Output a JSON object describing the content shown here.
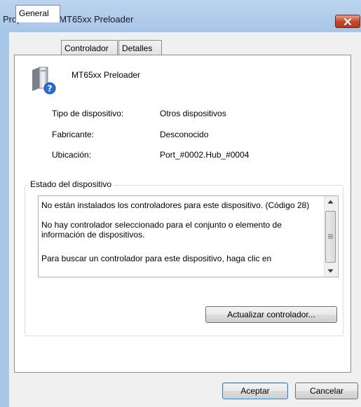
{
  "window": {
    "title": "Propiedades: MT65xx Preloader"
  },
  "tabs": [
    {
      "label": "General"
    },
    {
      "label": "Controlador"
    },
    {
      "label": "Detalles"
    }
  ],
  "device": {
    "name": "MT65xx Preloader",
    "icon": "device-unknown-icon"
  },
  "properties": [
    {
      "label": "Tipo de dispositivo:",
      "value": "Otros dispositivos"
    },
    {
      "label": "Fabricante:",
      "value": "Desconocido"
    },
    {
      "label": "Ubicación:",
      "value": "Port_#0002.Hub_#0004"
    }
  ],
  "status": {
    "group_title": "Estado del dispositivo",
    "paragraphs": [
      "No están instalados los controladores para este dispositivo. (Código 28)",
      "No hay controlador seleccionado para el conjunto o elemento de información de dispositivos.",
      "Para buscar un controlador para este dispositivo, haga clic en"
    ],
    "update_button": "Actualizar controlador..."
  },
  "buttons": {
    "ok": "Aceptar",
    "cancel": "Cancelar"
  }
}
